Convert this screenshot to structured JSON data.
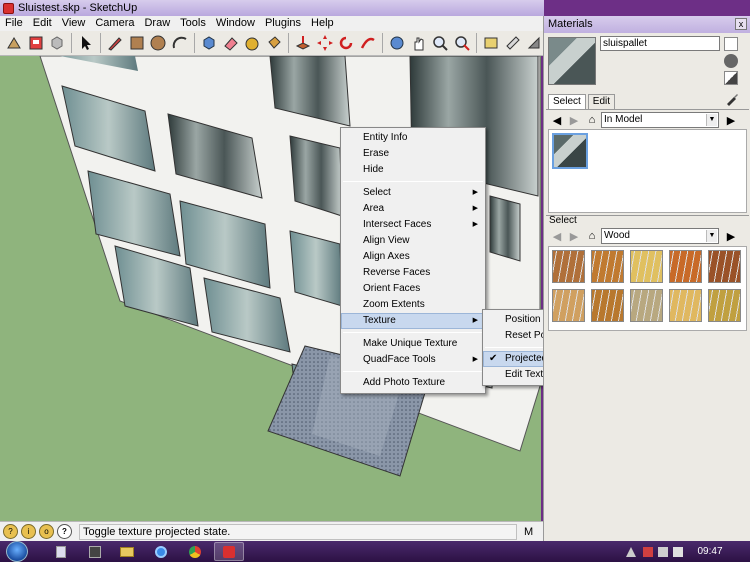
{
  "window": {
    "title": "Sluistest.skp - SketchUp"
  },
  "menubar": [
    "File",
    "Edit",
    "View",
    "Camera",
    "Draw",
    "Tools",
    "Window",
    "Plugins",
    "Help"
  ],
  "context_menu": {
    "items": [
      {
        "label": "Entity Info"
      },
      {
        "label": "Erase"
      },
      {
        "label": "Hide"
      },
      {
        "sep": true
      },
      {
        "label": "Select",
        "submenu": true
      },
      {
        "label": "Area",
        "submenu": true
      },
      {
        "label": "Intersect Faces",
        "submenu": true
      },
      {
        "label": "Align View"
      },
      {
        "label": "Align Axes"
      },
      {
        "label": "Reverse Faces"
      },
      {
        "label": "Orient Faces"
      },
      {
        "label": "Zoom Extents"
      },
      {
        "label": "Texture",
        "submenu": true,
        "highlighted": true
      },
      {
        "sep": true
      },
      {
        "label": "Make Unique Texture"
      },
      {
        "label": "QuadFace Tools",
        "submenu": true
      },
      {
        "sep": true
      },
      {
        "label": "Add Photo Texture"
      }
    ]
  },
  "texture_submenu": {
    "items": [
      {
        "label": "Position"
      },
      {
        "label": "Reset Position"
      },
      {
        "sep": true
      },
      {
        "label": "Projected",
        "checked": true,
        "highlighted": true
      },
      {
        "label": "Edit Texture Image..."
      }
    ]
  },
  "status": {
    "text": "Toggle texture projected state.",
    "measure_label": "M"
  },
  "materials_panel": {
    "title": "Materials",
    "close": "x",
    "material_name": "sluispallet",
    "tabs": [
      "Select",
      "Edit"
    ],
    "top_collection": "In Model",
    "lower_label": "Select",
    "lower_collection": "Wood",
    "wood_swatches": [
      "#b0703a",
      "#c07a30",
      "#e0c060",
      "#c86a28",
      "#9a5228",
      "#d0a060",
      "#b8782e",
      "#b8a880",
      "#e0b860",
      "#c0a040"
    ]
  },
  "taskbar": {
    "clock": "09:47"
  },
  "colors": {
    "accent": "#c8d8ee",
    "titlebar": "#c0b0e0",
    "ground": "#8fb47d"
  }
}
